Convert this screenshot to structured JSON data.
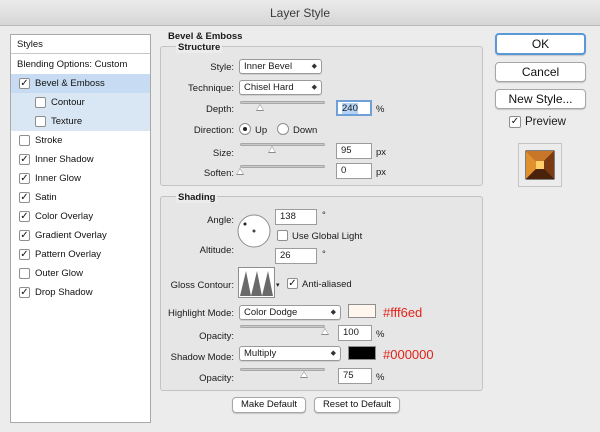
{
  "window": {
    "title": "Layer Style"
  },
  "sidebar": {
    "header": "Styles",
    "items": [
      {
        "label": "Blending Options: Custom",
        "checkbox": false,
        "checked": false,
        "indent": 0,
        "state": "header"
      },
      {
        "label": "Bevel & Emboss",
        "checkbox": true,
        "checked": true,
        "indent": 1,
        "state": "selected"
      },
      {
        "label": "Contour",
        "checkbox": true,
        "checked": false,
        "indent": 2,
        "state": "sub"
      },
      {
        "label": "Texture",
        "checkbox": true,
        "checked": false,
        "indent": 2,
        "state": "sub"
      },
      {
        "label": "Stroke",
        "checkbox": true,
        "checked": false,
        "indent": 1,
        "state": "normal"
      },
      {
        "label": "Inner Shadow",
        "checkbox": true,
        "checked": true,
        "indent": 1,
        "state": "normal"
      },
      {
        "label": "Inner Glow",
        "checkbox": true,
        "checked": true,
        "indent": 1,
        "state": "normal"
      },
      {
        "label": "Satin",
        "checkbox": true,
        "checked": true,
        "indent": 1,
        "state": "normal"
      },
      {
        "label": "Color Overlay",
        "checkbox": true,
        "checked": true,
        "indent": 1,
        "state": "normal"
      },
      {
        "label": "Gradient Overlay",
        "checkbox": true,
        "checked": true,
        "indent": 1,
        "state": "normal"
      },
      {
        "label": "Pattern Overlay",
        "checkbox": true,
        "checked": true,
        "indent": 1,
        "state": "normal"
      },
      {
        "label": "Outer Glow",
        "checkbox": true,
        "checked": false,
        "indent": 1,
        "state": "normal"
      },
      {
        "label": "Drop Shadow",
        "checkbox": true,
        "checked": true,
        "indent": 1,
        "state": "normal"
      }
    ]
  },
  "bevel": {
    "title": "Bevel & Emboss",
    "structure": {
      "title": "Structure",
      "style_label": "Style:",
      "style_value": "Inner Bevel",
      "technique_label": "Technique:",
      "technique_value": "Chisel Hard",
      "depth_label": "Depth:",
      "depth_value": "240",
      "depth_unit": "%",
      "depth_level": 0.24,
      "direction_label": "Direction:",
      "direction_up": "Up",
      "direction_down": "Down",
      "direction_selected": "Up",
      "size_label": "Size:",
      "size_value": "95",
      "size_unit": "px",
      "size_level": 0.38,
      "soften_label": "Soften:",
      "soften_value": "0",
      "soften_unit": "px",
      "soften_level": 0.0
    },
    "shading": {
      "title": "Shading",
      "angle_label": "Angle:",
      "angle_value": "138",
      "angle_unit": "°",
      "use_global_light": "Use Global Light",
      "use_global_light_checked": false,
      "altitude_label": "Altitude:",
      "altitude_value": "26",
      "altitude_unit": "°",
      "gloss_contour_label": "Gloss Contour:",
      "anti_aliased": "Anti-aliased",
      "anti_aliased_checked": true,
      "highlight_mode_label": "Highlight Mode:",
      "highlight_mode_value": "Color Dodge",
      "highlight_color": "#fff6ed",
      "highlight_note": "#fff6ed",
      "highlight_opacity_label": "Opacity:",
      "highlight_opacity_value": "100",
      "highlight_opacity_unit": "%",
      "highlight_opacity_level": 1.0,
      "shadow_mode_label": "Shadow Mode:",
      "shadow_mode_value": "Multiply",
      "shadow_color": "#000000",
      "shadow_note": "#000000",
      "shadow_opacity_label": "Opacity:",
      "shadow_opacity_value": "75",
      "shadow_opacity_unit": "%",
      "shadow_opacity_level": 0.75
    },
    "make_default": "Make Default",
    "reset_default": "Reset to Default"
  },
  "actions": {
    "ok": "OK",
    "cancel": "Cancel",
    "new_style": "New Style...",
    "preview_label": "Preview",
    "preview_checked": true
  },
  "colors": {
    "accent": "#5b98d8",
    "selection": "#c7dcf2",
    "annotation": "#e2231a"
  }
}
